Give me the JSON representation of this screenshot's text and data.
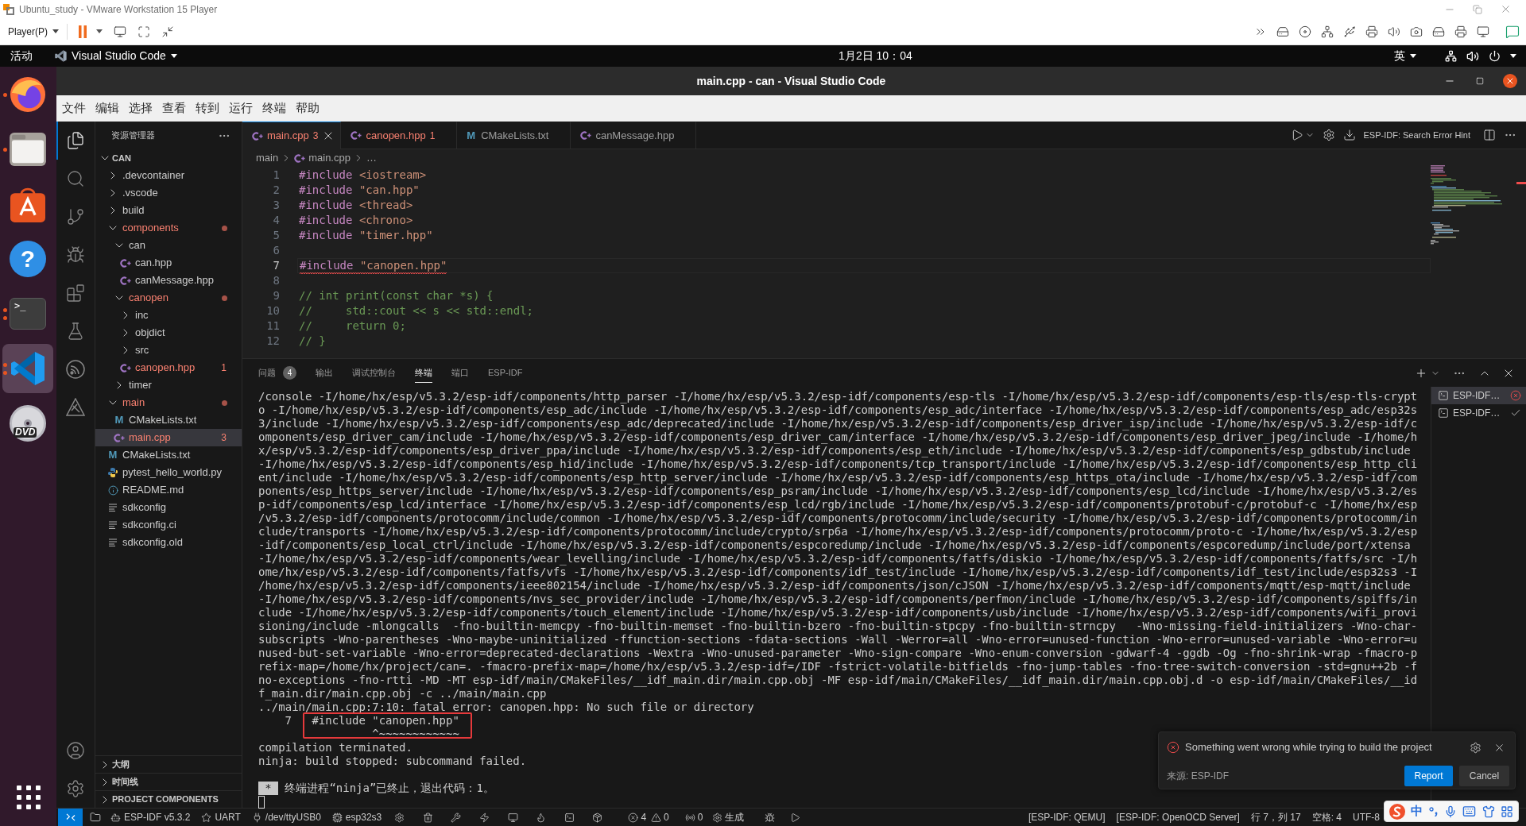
{
  "vmware": {
    "title": "Ubuntu_study - VMware Workstation 15 Player",
    "player_menu": "Player(P)"
  },
  "topbar": {
    "activities": "活动",
    "app_menu": "Visual Studio Code",
    "clock": "1月2日 10：04",
    "input_method": "英"
  },
  "dock": [
    {
      "kind": "browser",
      "running": true,
      "multiple": false,
      "selected": false
    },
    {
      "kind": "files",
      "running": true,
      "multiple": false,
      "selected": false
    },
    {
      "kind": "store",
      "running": false,
      "multiple": false,
      "selected": false
    },
    {
      "kind": "help",
      "glyph": "?",
      "running": false,
      "multiple": false,
      "selected": false
    },
    {
      "kind": "terminal",
      "glyph": ">_",
      "running": true,
      "multiple": true,
      "selected": false
    },
    {
      "kind": "editor",
      "running": true,
      "multiple": true,
      "selected": true
    },
    {
      "kind": "disc",
      "glyph": "DVD",
      "running": false,
      "multiple": false,
      "selected": false
    }
  ],
  "vscode": {
    "title": "main.cpp - can - Visual Studio Code",
    "menu": [
      "文件",
      "编辑",
      "选择",
      "查看",
      "转到",
      "运行",
      "终端",
      "帮助"
    ],
    "activity_bar": [
      {
        "selected": true
      },
      {
        "selected": false
      },
      {
        "selected": false
      },
      {
        "selected": false
      },
      {
        "selected": false
      },
      {
        "selected": false
      },
      {
        "selected": false
      },
      {
        "selected": false
      }
    ],
    "explorer": {
      "title": "资源管理器",
      "root": {
        "label": "CAN",
        "expanded": true
      },
      "tree": [
        {
          "label": ".devcontainer",
          "kind": "folder",
          "expanded": false,
          "error": false,
          "selected": false
        },
        {
          "label": ".vscode",
          "kind": "folder",
          "expanded": false,
          "error": false,
          "selected": false
        },
        {
          "label": "build",
          "kind": "folder",
          "expanded": false,
          "error": false,
          "selected": false
        },
        {
          "label": "components",
          "kind": "folder",
          "expanded": true,
          "error": true,
          "selected": false,
          "children": [
            {
              "label": "can",
              "kind": "folder",
              "expanded": true,
              "error": false,
              "selected": false,
              "children": [
                {
                  "label": "can.hpp",
                  "kind": "cpp",
                  "error": false,
                  "selected": false
                },
                {
                  "label": "canMessage.hpp",
                  "kind": "cpp",
                  "error": false,
                  "selected": false
                }
              ]
            },
            {
              "label": "canopen",
              "kind": "folder",
              "expanded": true,
              "error": true,
              "selected": false,
              "children": [
                {
                  "label": "inc",
                  "kind": "folder",
                  "expanded": false,
                  "error": false,
                  "selected": false
                },
                {
                  "label": "objdict",
                  "kind": "folder",
                  "expanded": false,
                  "error": false,
                  "selected": false
                },
                {
                  "label": "src",
                  "kind": "folder",
                  "expanded": false,
                  "error": false,
                  "selected": false
                },
                {
                  "label": "canopen.hpp",
                  "kind": "cpp",
                  "error": true,
                  "problems": "1",
                  "selected": false
                }
              ]
            },
            {
              "label": "timer",
              "kind": "folder",
              "expanded": false,
              "error": false,
              "selected": false
            }
          ]
        },
        {
          "label": "main",
          "kind": "folder",
          "expanded": true,
          "error": true,
          "selected": false,
          "children": [
            {
              "label": "CMakeLists.txt",
              "kind": "cmake",
              "glyph": "M",
              "error": false,
              "selected": false
            },
            {
              "label": "main.cpp",
              "kind": "cpp",
              "error": true,
              "problems": "3",
              "selected": true
            }
          ]
        },
        {
          "label": "CMakeLists.txt",
          "kind": "cmake",
          "glyph": "M",
          "error": false,
          "selected": false
        },
        {
          "label": "pytest_hello_world.py",
          "kind": "python",
          "error": false,
          "selected": false
        },
        {
          "label": "README.md",
          "kind": "readme",
          "error": false,
          "selected": false
        },
        {
          "label": "sdkconfig",
          "kind": "config",
          "error": false,
          "selected": false
        },
        {
          "label": "sdkconfig.ci",
          "kind": "config",
          "error": false,
          "selected": false
        },
        {
          "label": "sdkconfig.old",
          "kind": "config",
          "error": false,
          "selected": false
        }
      ],
      "sections": [
        {
          "label": "大纲",
          "expanded": false
        },
        {
          "label": "时间线",
          "expanded": false
        },
        {
          "label": "PROJECT COMPONENTS",
          "expanded": false
        }
      ]
    },
    "tabs": [
      {
        "label": "main.cpp",
        "kind": "cpp",
        "problems": "3",
        "error": true,
        "selected": true
      },
      {
        "label": "canopen.hpp",
        "kind": "cpp",
        "problems": "1",
        "error": true,
        "selected": false
      },
      {
        "label": "CMakeLists.txt",
        "kind": "cmake",
        "glyph": "M",
        "error": false,
        "selected": false
      },
      {
        "label": "canMessage.hpp",
        "kind": "cpp",
        "error": false,
        "selected": false
      }
    ],
    "editor_actions": {
      "hint": "ESP-IDF: Search Error Hint"
    },
    "breadcrumb": [
      {
        "label": "main",
        "kind": "folder"
      },
      {
        "label": "main.cpp",
        "kind": "cpp"
      },
      {
        "label": "…",
        "kind": "symbol"
      }
    ],
    "code_lines": [
      {
        "number": "1",
        "kind": "include",
        "directive": "#include",
        "target": "<iostream>",
        "current": false,
        "error": false
      },
      {
        "number": "2",
        "kind": "include",
        "directive": "#include",
        "target": "\"can.hpp\"",
        "current": false,
        "error": false
      },
      {
        "number": "3",
        "kind": "include",
        "directive": "#include",
        "target": "<thread>",
        "current": false,
        "error": false
      },
      {
        "number": "4",
        "kind": "include",
        "directive": "#include",
        "target": "<chrono>",
        "current": false,
        "error": false
      },
      {
        "number": "5",
        "kind": "include",
        "directive": "#include",
        "target": "\"timer.hpp\"",
        "current": false,
        "error": false
      },
      {
        "number": "6",
        "kind": "blank",
        "current": false
      },
      {
        "number": "7",
        "kind": "include",
        "directive": "#include",
        "target": "\"canopen.hpp\"",
        "current": true,
        "error": true
      },
      {
        "number": "8",
        "kind": "blank",
        "current": false
      },
      {
        "number": "9",
        "kind": "comment",
        "text": "// int print(const char *s) {",
        "current": false,
        "error": false
      },
      {
        "number": "10",
        "kind": "comment",
        "text": "//     std::cout << s << std::endl;",
        "current": false,
        "error": false
      },
      {
        "number": "11",
        "kind": "comment",
        "text": "//     return 0;",
        "current": false,
        "error": false
      },
      {
        "number": "12",
        "kind": "comment",
        "text": "// }",
        "current": false,
        "error": false
      }
    ],
    "panel": {
      "tabs": [
        {
          "label": "问题",
          "badge": "4",
          "selected": false
        },
        {
          "label": "输出",
          "selected": false
        },
        {
          "label": "调试控制台",
          "selected": false
        },
        {
          "label": "终端",
          "selected": true
        },
        {
          "label": "端口",
          "selected": false
        },
        {
          "label": "ESP-IDF",
          "selected": false
        }
      ],
      "terminal": {
        "output": [
          "/console -I/home/hx/esp/v5.3.2/esp-idf/components/http_parser -I/home/hx/esp/v5.3.2/esp-idf/components/esp-tls -I/home/hx/esp/v5.3.2/esp-idf/components/esp-tls/esp-tls-crypt",
          "o -I/home/hx/esp/v5.3.2/esp-idf/components/esp_adc/include -I/home/hx/esp/v5.3.2/esp-idf/components/esp_adc/interface -I/home/hx/esp/v5.3.2/esp-idf/components/esp_adc/esp32s",
          "3/include -I/home/hx/esp/v5.3.2/esp-idf/components/esp_adc/deprecated/include -I/home/hx/esp/v5.3.2/esp-idf/components/esp_driver_isp/include -I/home/hx/esp/v5.3.2/esp-idf/c",
          "omponents/esp_driver_cam/include -I/home/hx/esp/v5.3.2/esp-idf/components/esp_driver_cam/interface -I/home/hx/esp/v5.3.2/esp-idf/components/esp_driver_jpeg/include -I/home/h",
          "x/esp/v5.3.2/esp-idf/components/esp_driver_ppa/include -I/home/hx/esp/v5.3.2/esp-idf/components/esp_eth/include -I/home/hx/esp/v5.3.2/esp-idf/components/esp_gdbstub/include",
          "-I/home/hx/esp/v5.3.2/esp-idf/components/esp_hid/include -I/home/hx/esp/v5.3.2/esp-idf/components/tcp_transport/include -I/home/hx/esp/v5.3.2/esp-idf/components/esp_http_cli",
          "ent/include -I/home/hx/esp/v5.3.2/esp-idf/components/esp_http_server/include -I/home/hx/esp/v5.3.2/esp-idf/components/esp_https_ota/include -I/home/hx/esp/v5.3.2/esp-idf/com",
          "ponents/esp_https_server/include -I/home/hx/esp/v5.3.2/esp-idf/components/esp_psram/include -I/home/hx/esp/v5.3.2/esp-idf/components/esp_lcd/include -I/home/hx/esp/v5.3.2/es",
          "p-idf/components/esp_lcd/interface -I/home/hx/esp/v5.3.2/esp-idf/components/esp_lcd/rgb/include -I/home/hx/esp/v5.3.2/esp-idf/components/protobuf-c/protobuf-c -I/home/hx/esp",
          "/v5.3.2/esp-idf/components/protocomm/include/common -I/home/hx/esp/v5.3.2/esp-idf/components/protocomm/include/security -I/home/hx/esp/v5.3.2/esp-idf/components/protocomm/in",
          "clude/transports -I/home/hx/esp/v5.3.2/esp-idf/components/protocomm/include/crypto/srp6a -I/home/hx/esp/v5.3.2/esp-idf/components/protocomm/proto-c -I/home/hx/esp/v5.3.2/esp",
          "-idf/components/esp_local_ctrl/include -I/home/hx/esp/v5.3.2/esp-idf/components/espcoredump/include -I/home/hx/esp/v5.3.2/esp-idf/components/espcoredump/include/port/xtensa",
          "-I/home/hx/esp/v5.3.2/esp-idf/components/wear_levelling/include -I/home/hx/esp/v5.3.2/esp-idf/components/fatfs/diskio -I/home/hx/esp/v5.3.2/esp-idf/components/fatfs/src -I/h",
          "ome/hx/esp/v5.3.2/esp-idf/components/fatfs/vfs -I/home/hx/esp/v5.3.2/esp-idf/components/idf_test/include -I/home/hx/esp/v5.3.2/esp-idf/components/idf_test/include/esp32s3 -I",
          "/home/hx/esp/v5.3.2/esp-idf/components/ieee802154/include -I/home/hx/esp/v5.3.2/esp-idf/components/json/cJSON -I/home/hx/esp/v5.3.2/esp-idf/components/mqtt/esp-mqtt/include",
          "-I/home/hx/esp/v5.3.2/esp-idf/components/nvs_sec_provider/include -I/home/hx/esp/v5.3.2/esp-idf/components/perfmon/include -I/home/hx/esp/v5.3.2/esp-idf/components/spiffs/in",
          "clude -I/home/hx/esp/v5.3.2/esp-idf/components/touch_element/include -I/home/hx/esp/v5.3.2/esp-idf/components/usb/include -I/home/hx/esp/v5.3.2/esp-idf/components/wifi_provi",
          "sioning/include -mlongcalls  -fno-builtin-memcpy -fno-builtin-memset -fno-builtin-bzero -fno-builtin-stpcpy -fno-builtin-strncpy   -Wno-missing-field-initializers -Wno-char-",
          "subscripts -Wno-parentheses -Wno-maybe-uninitialized -ffunction-sections -fdata-sections -Wall -Werror=all -Wno-error=unused-function -Wno-error=unused-variable -Wno-error=u",
          "nused-but-set-variable -Wno-error=deprecated-declarations -Wextra -Wno-unused-parameter -Wno-sign-compare -Wno-enum-conversion -gdwarf-4 -ggdb -Og -fno-shrink-wrap -fmacro-p",
          "refix-map=/home/hx/project/can=. -fmacro-prefix-map=/home/hx/esp/v5.3.2/esp-idf=/IDF -fstrict-volatile-bitfields -fno-jump-tables -fno-tree-switch-conversion -std=gnu++2b -f",
          "no-exceptions -fno-rtti -MD -MT esp-idf/main/CMakeFiles/__idf_main.dir/main.cpp.obj -MF esp-idf/main/CMakeFiles/__idf_main.dir/main.cpp.obj.d -o esp-idf/main/CMakeFiles/__id",
          "f_main.dir/main.cpp.obj -c ../main/main.cpp",
          "../main/main.cpp:7:10: fatal error: canopen.hpp: No such file or directory"
        ],
        "snippet": {
          "line_number": "7",
          "code": "#include \"canopen.hpp\"",
          "marker": "^~~~~~~~~~~~~"
        },
        "after": [
          "compilation terminated.",
          "ninja: build stopped: subcommand failed."
        ],
        "exit": {
          "marker": "*",
          "message": "终端进程“ninja”已终止，退出代码：1。"
        }
      },
      "terminal_list": [
        {
          "label": "ESP-IDF…",
          "failed": true,
          "selected": true
        },
        {
          "label": "ESP-IDF…",
          "failed": false,
          "selected": false
        }
      ]
    },
    "notification": {
      "message": "Something went wrong while trying to build the project",
      "source": "来源: ESP-IDF",
      "buttons": [
        {
          "label": "Report",
          "kind": "primary"
        },
        {
          "label": "Cancel",
          "kind": "secondary"
        }
      ]
    },
    "status_bar": {
      "left": [
        "ESP-IDF v5.3.2",
        "UART",
        "/dev/ttyUSB0",
        "esp32s3"
      ],
      "errors": "4",
      "warnings": "0",
      "ports": "0",
      "build": "生成",
      "right": [
        "[ESP-IDF: QEMU]",
        "[ESP-IDF: OpenOCD Server]",
        "行 7，列 17",
        "空格: 4",
        "UTF-8"
      ]
    }
  },
  "ime_toolbar": {
    "mode": "中"
  }
}
